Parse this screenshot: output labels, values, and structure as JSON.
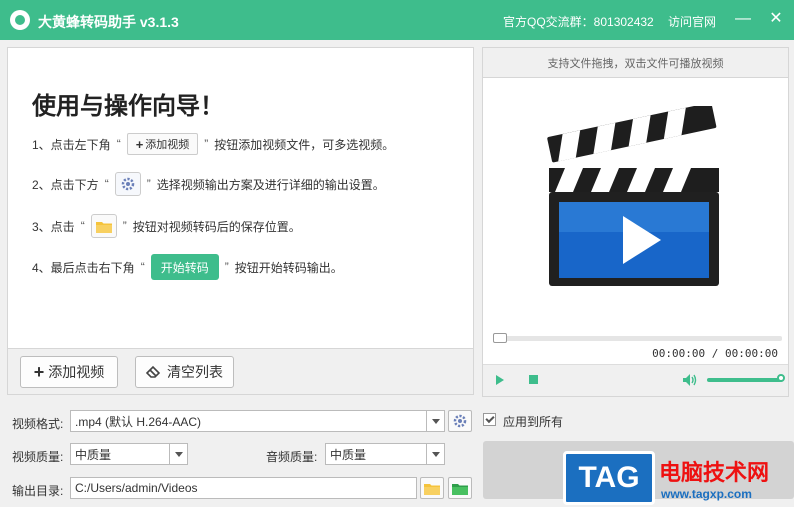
{
  "window": {
    "title": "大黄蜂转码助手 v3.1.3",
    "qq_group": "官方QQ交流群：801302432",
    "visit_site": "访问官网",
    "minimize": "—",
    "close": "✕"
  },
  "guide": {
    "title": "使用与操作向导！",
    "step1": {
      "prefix": "1、点击左下角",
      "q_open": "“",
      "q_close": "”",
      "button": "添加视频",
      "suffix": "按钮添加视频文件，可多选视频。"
    },
    "step2": {
      "prefix": "2、点击下方",
      "q_open": "“",
      "q_close": "”",
      "suffix": "选择视频输出方案及进行详细的输出设置。"
    },
    "step3": {
      "prefix": "3、点击",
      "q_open": "“",
      "q_close": "”",
      "suffix": "按钮对视频转码后的保存位置。"
    },
    "step4": {
      "prefix": "4、最后点击右下角",
      "q_open": "“",
      "q_close": "”",
      "button": "开始转码",
      "suffix": "按钮开始转码输出。"
    }
  },
  "actions": {
    "add_video": "添加视频",
    "clear_list": "清空列表"
  },
  "preview": {
    "hint": "支持文件拖拽，双击文件可播放视频",
    "time": "00:00:00 / 00:00:00",
    "progress": 0.0,
    "volume": 1.0
  },
  "settings": {
    "format_label": "视频格式:",
    "format_value": ".mp4 (默认 H.264-AAC)",
    "apply_all": "应用到所有",
    "video_quality_label": "视频质量:",
    "video_quality_value": "中质量",
    "audio_quality_label": "音频质量:",
    "audio_quality_value": "中质量",
    "output_label": "输出目录:",
    "output_value": "C:/Users/admin/Videos"
  },
  "watermark": {
    "tag": "TAG",
    "site_name": "电脑技术网",
    "url": "www.tagxp.com"
  },
  "colors": {
    "accent": "#3ebd8c",
    "folder": "#f5c33b",
    "watermark_blue": "#1b6fc0",
    "watermark_red": "#ee1111"
  }
}
